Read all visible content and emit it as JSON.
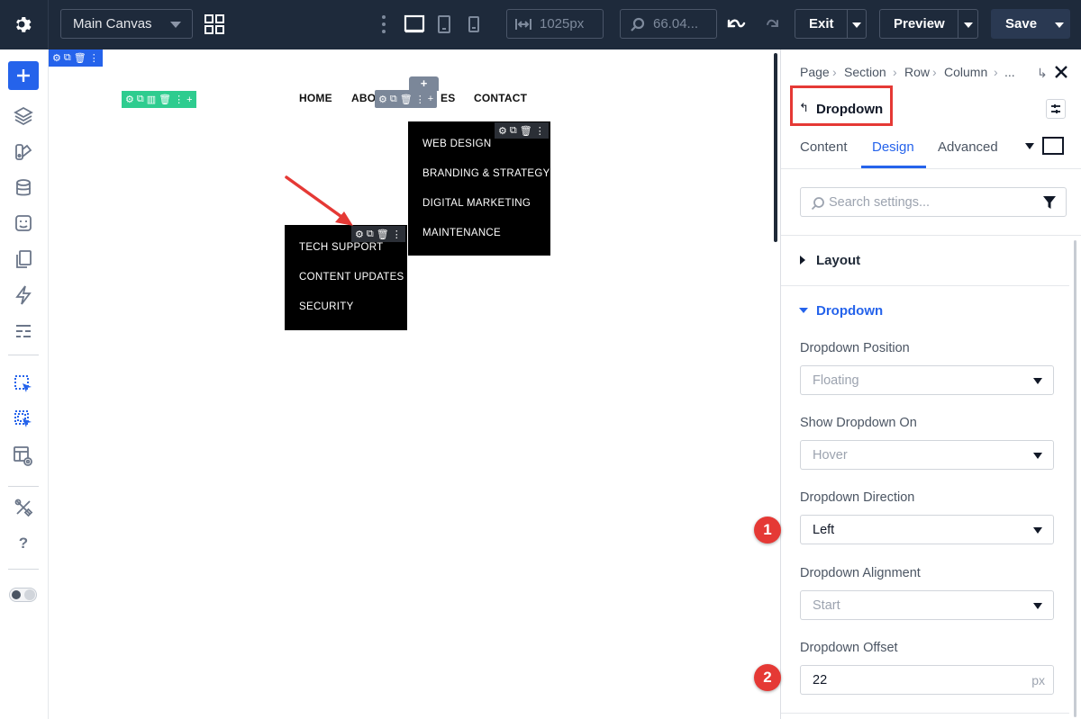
{
  "topbar": {
    "canvas_select": "Main Canvas",
    "width_value": "1025px",
    "zoom_value": "66.04...",
    "exit_label": "Exit",
    "preview_label": "Preview",
    "save_label": "Save"
  },
  "canvas": {
    "nav": [
      "HOME",
      "ABOU",
      "ES",
      "CONTACT"
    ],
    "dropdown_main": [
      "WEB DESIGN",
      "BRANDING & STRATEGY",
      "DIGITAL MARKETING",
      "MAINTENANCE"
    ],
    "dropdown_sub": [
      "TECH SUPPORT",
      "CONTENT UPDATES",
      "SECURITY"
    ],
    "add_symbol": "+"
  },
  "panel": {
    "breadcrumb": [
      "Page",
      "Section",
      "Row",
      "Column",
      "..."
    ],
    "title": "Dropdown",
    "tabs": [
      "Content",
      "Design",
      "Advanced"
    ],
    "active_tab": "Design",
    "search_placeholder": "Search settings...",
    "sections": {
      "layout": "Layout",
      "dropdown": "Dropdown"
    },
    "fields": {
      "position": {
        "label": "Dropdown Position",
        "value": "Floating"
      },
      "show_on": {
        "label": "Show Dropdown On",
        "value": "Hover"
      },
      "direction": {
        "label": "Dropdown Direction",
        "value": "Left"
      },
      "alignment": {
        "label": "Dropdown Alignment",
        "value": "Start"
      },
      "offset": {
        "label": "Dropdown Offset",
        "value": "22",
        "unit": "px"
      }
    },
    "badges": [
      "1",
      "2"
    ]
  },
  "colors": {
    "topbar_bg": "#1e2a3b",
    "accent_blue": "#2563eb",
    "highlight_red": "#e53935",
    "section_green": "#2ecc8f",
    "module_gray": "#7b8799"
  }
}
